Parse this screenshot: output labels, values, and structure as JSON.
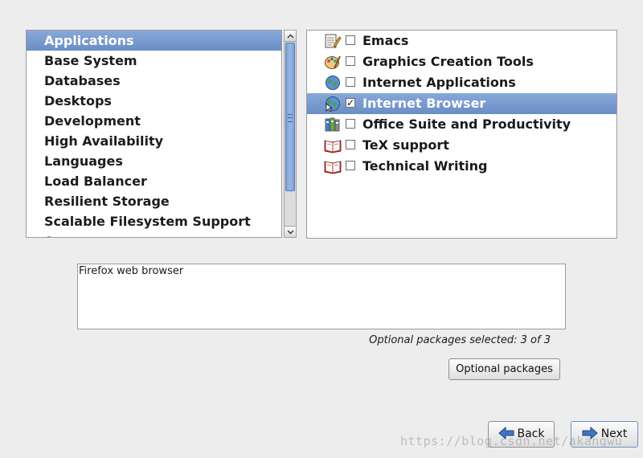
{
  "categories": {
    "items": [
      {
        "label": "Applications",
        "selected": true
      },
      {
        "label": "Base System",
        "selected": false
      },
      {
        "label": "Databases",
        "selected": false
      },
      {
        "label": "Desktops",
        "selected": false
      },
      {
        "label": "Development",
        "selected": false
      },
      {
        "label": "High Availability",
        "selected": false
      },
      {
        "label": "Languages",
        "selected": false
      },
      {
        "label": "Load Balancer",
        "selected": false
      },
      {
        "label": "Resilient Storage",
        "selected": false
      },
      {
        "label": "Scalable Filesystem Support",
        "selected": false
      },
      {
        "label": "Servers",
        "selected": false
      }
    ]
  },
  "packages": {
    "items": [
      {
        "label": "Emacs",
        "checked": false,
        "selected": false,
        "icon": "notepad-pencil-icon"
      },
      {
        "label": "Graphics Creation Tools",
        "checked": false,
        "selected": false,
        "icon": "paint-palette-icon"
      },
      {
        "label": "Internet Applications",
        "checked": false,
        "selected": false,
        "icon": "globe-icon"
      },
      {
        "label": "Internet Browser",
        "checked": true,
        "selected": true,
        "icon": "globe-pointer-icon"
      },
      {
        "label": "Office Suite and Productivity",
        "checked": false,
        "selected": false,
        "icon": "office-binders-icon"
      },
      {
        "label": "TeX support",
        "checked": false,
        "selected": false,
        "icon": "open-book-icon"
      },
      {
        "label": "Technical Writing",
        "checked": false,
        "selected": false,
        "icon": "open-book-icon"
      }
    ]
  },
  "description": {
    "text": "Firefox web browser"
  },
  "status": {
    "optional_selected": "Optional packages selected: 3 of 3"
  },
  "buttons": {
    "optional_packages": "Optional packages",
    "back": "Back",
    "next": "Next"
  },
  "watermark": {
    "text": "https://blog.csdn.net/akangwu"
  },
  "colors": {
    "selection": "#7b9bd0",
    "background": "#ededed"
  }
}
